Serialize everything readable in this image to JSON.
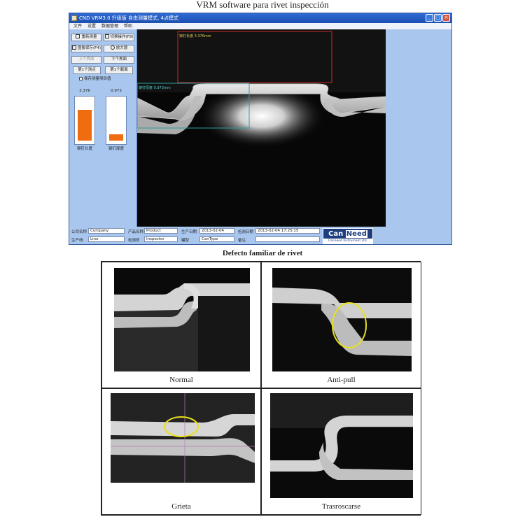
{
  "page_title": "VRM software para rivet inspección",
  "app": {
    "window_title": "CND VRM3.0 升级版  自由测量模式, 4点模式",
    "menus": [
      "文件",
      "设置",
      "数据管理",
      "帮助"
    ],
    "buttons": {
      "reset_measure": "重新测量",
      "switch_operation": "切换操作(F8)",
      "image_save": "图像保存(F4)",
      "enlarge": "放大镜",
      "prev_page": "上个界面",
      "next_page": "下个界面",
      "report_next_point": "第1个测点",
      "report_next_section": "第1个截面"
    },
    "checkbox_label": "保存测量项目值",
    "gauges": [
      {
        "value": "3.376",
        "label": "铆钉长度",
        "fill": 0.75
      },
      {
        "value": "0.973",
        "label": "铆钉厚度",
        "fill": 0.15
      }
    ],
    "overlays": {
      "length_label": "铆钉长度 3.376mm",
      "thickness_label": "铆钉厚度 0.973mm"
    },
    "bottom": {
      "company_label": "公司名称",
      "company_value": "Company",
      "product_label": "产品名称",
      "product_value": "Product",
      "date_label": "生产日期",
      "date_value": "2013-02-04",
      "check_date_label": "检测日期",
      "check_date_value": "2013-02-04 17:25:15",
      "line_label": "生产线",
      "line_value": "Line",
      "inspector_label": "检测员",
      "inspector_value": "Inspector",
      "type_label": "罐型",
      "type_value": "CanType",
      "remark_label": "备注",
      "remark_value": ""
    },
    "logo": {
      "can": "Can",
      "need": "Need",
      "tagline": "Canneed Instrument Ltd."
    },
    "colors": {
      "gauge_fill": "#f06c10",
      "panel": "#a8c6ee",
      "titlebar": "#2f6bd6"
    }
  },
  "defects": {
    "title": "Defecto familiar de rivet",
    "cases": [
      {
        "caption": "Normal"
      },
      {
        "caption": "Anti-pull"
      },
      {
        "caption": "Grieta"
      },
      {
        "caption": "Trasroscarse"
      }
    ],
    "highlight_color": "#e8e01a"
  }
}
